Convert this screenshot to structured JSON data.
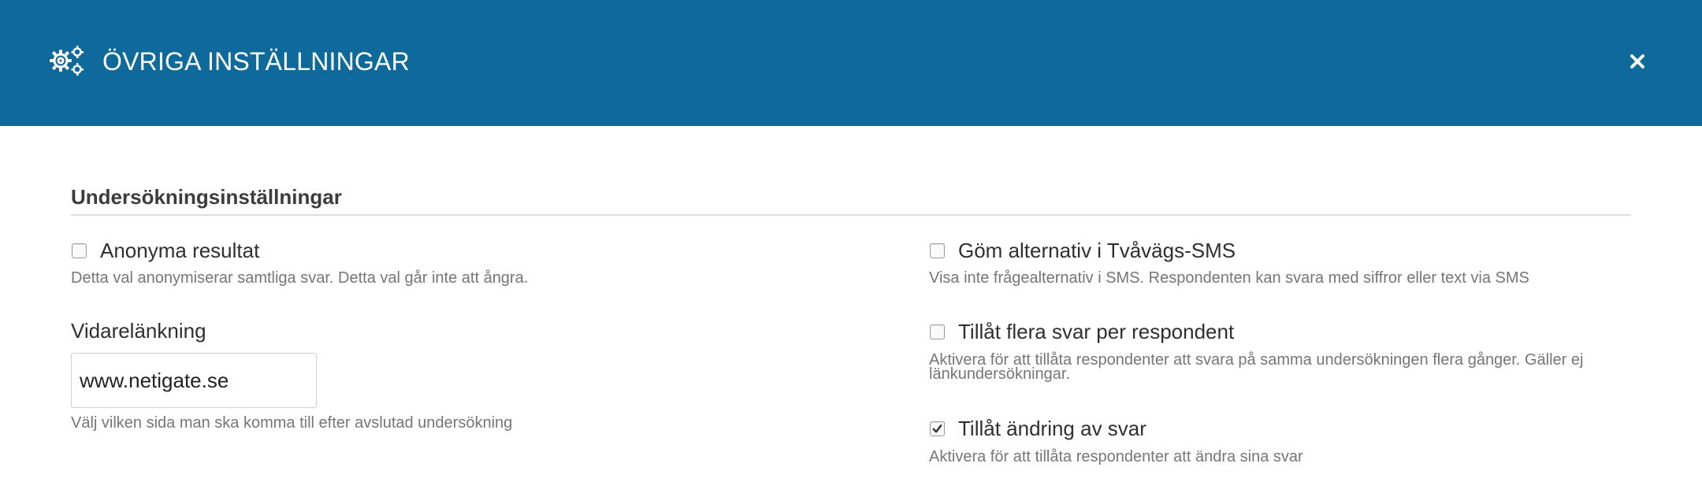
{
  "header": {
    "icon": "gears-icon",
    "title": "ÖVRIGA INSTÄLLNINGAR",
    "close_icon": "close-icon",
    "background_color": "#0f6a9c"
  },
  "section": {
    "title": "Undersökningsinställningar"
  },
  "left": {
    "anonymous": {
      "label": "Anonyma resultat",
      "checked": false,
      "help": "Detta val anonymiserar samtliga svar. Detta val går inte att ångra."
    },
    "redirect": {
      "label": "Vidarelänkning",
      "value": "www.netigate.se",
      "help": "Välj vilken sida man ska komma till efter avslutad undersökning"
    }
  },
  "right": {
    "hide_sms_options": {
      "label": "Göm alternativ i Tvåvägs-SMS",
      "checked": false,
      "help": "Visa inte frågealternativ i SMS. Respondenten kan svara med siffror eller text via SMS"
    },
    "multiple_answers": {
      "label": "Tillåt flera svar per respondent",
      "checked": false,
      "help_line1": "Aktivera för att tillåta respondenter att svara på samma undersökningen flera gånger. Gäller ej",
      "help_line2": "länkundersökningar."
    },
    "allow_edit": {
      "label": "Tillåt ändring av svar",
      "checked": true,
      "help": "Aktivera för att tillåta respondenter att ändra sina svar"
    }
  }
}
